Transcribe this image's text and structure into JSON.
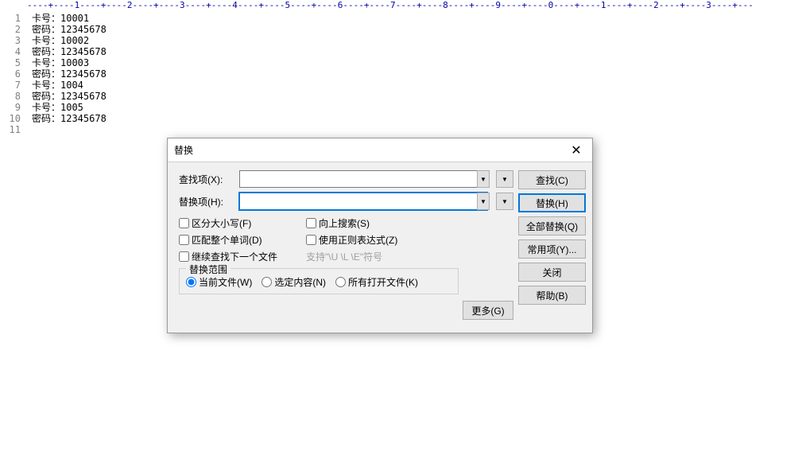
{
  "ruler": "----+----1----+----2----+----3----+----4----+----5----+----6----+----7----+----8----+----9----+----0----+----1----+----2----+----3----+---",
  "editor": {
    "lines": [
      "卡号：10001",
      "密码：12345678",
      "卡号：10002",
      "密码：12345678",
      "卡号：10003",
      "密码：12345678",
      "卡号：1004",
      "密码：12345678",
      "卡号：1005",
      "密码：12345678",
      ""
    ],
    "line_numbers": [
      "1",
      "2",
      "3",
      "4",
      "5",
      "6",
      "7",
      "8",
      "9",
      "10",
      "11"
    ]
  },
  "dialog": {
    "title": "替换",
    "find_label": "查找项(X):",
    "replace_label": "替换项(H):",
    "find_value": "",
    "replace_value": "",
    "checks": {
      "case": "区分大小写(F)",
      "whole": "匹配整个单词(D)",
      "up": "向上搜索(S)",
      "regex": "使用正则表达式(Z)",
      "next_file": "继续查找下一个文件",
      "hint": "支持\"\\U \\L \\E\"符号"
    },
    "scope": {
      "title": "替换范围",
      "current": "当前文件(W)",
      "selection": "选定内容(N)",
      "all_open": "所有打开文件(K)"
    },
    "buttons": {
      "find": "查找(C)",
      "replace": "替换(H)",
      "replace_all": "全部替换(Q)",
      "common": "常用项(Y)...",
      "close": "关闭",
      "help": "帮助(B)",
      "more": "更多(G)"
    }
  }
}
